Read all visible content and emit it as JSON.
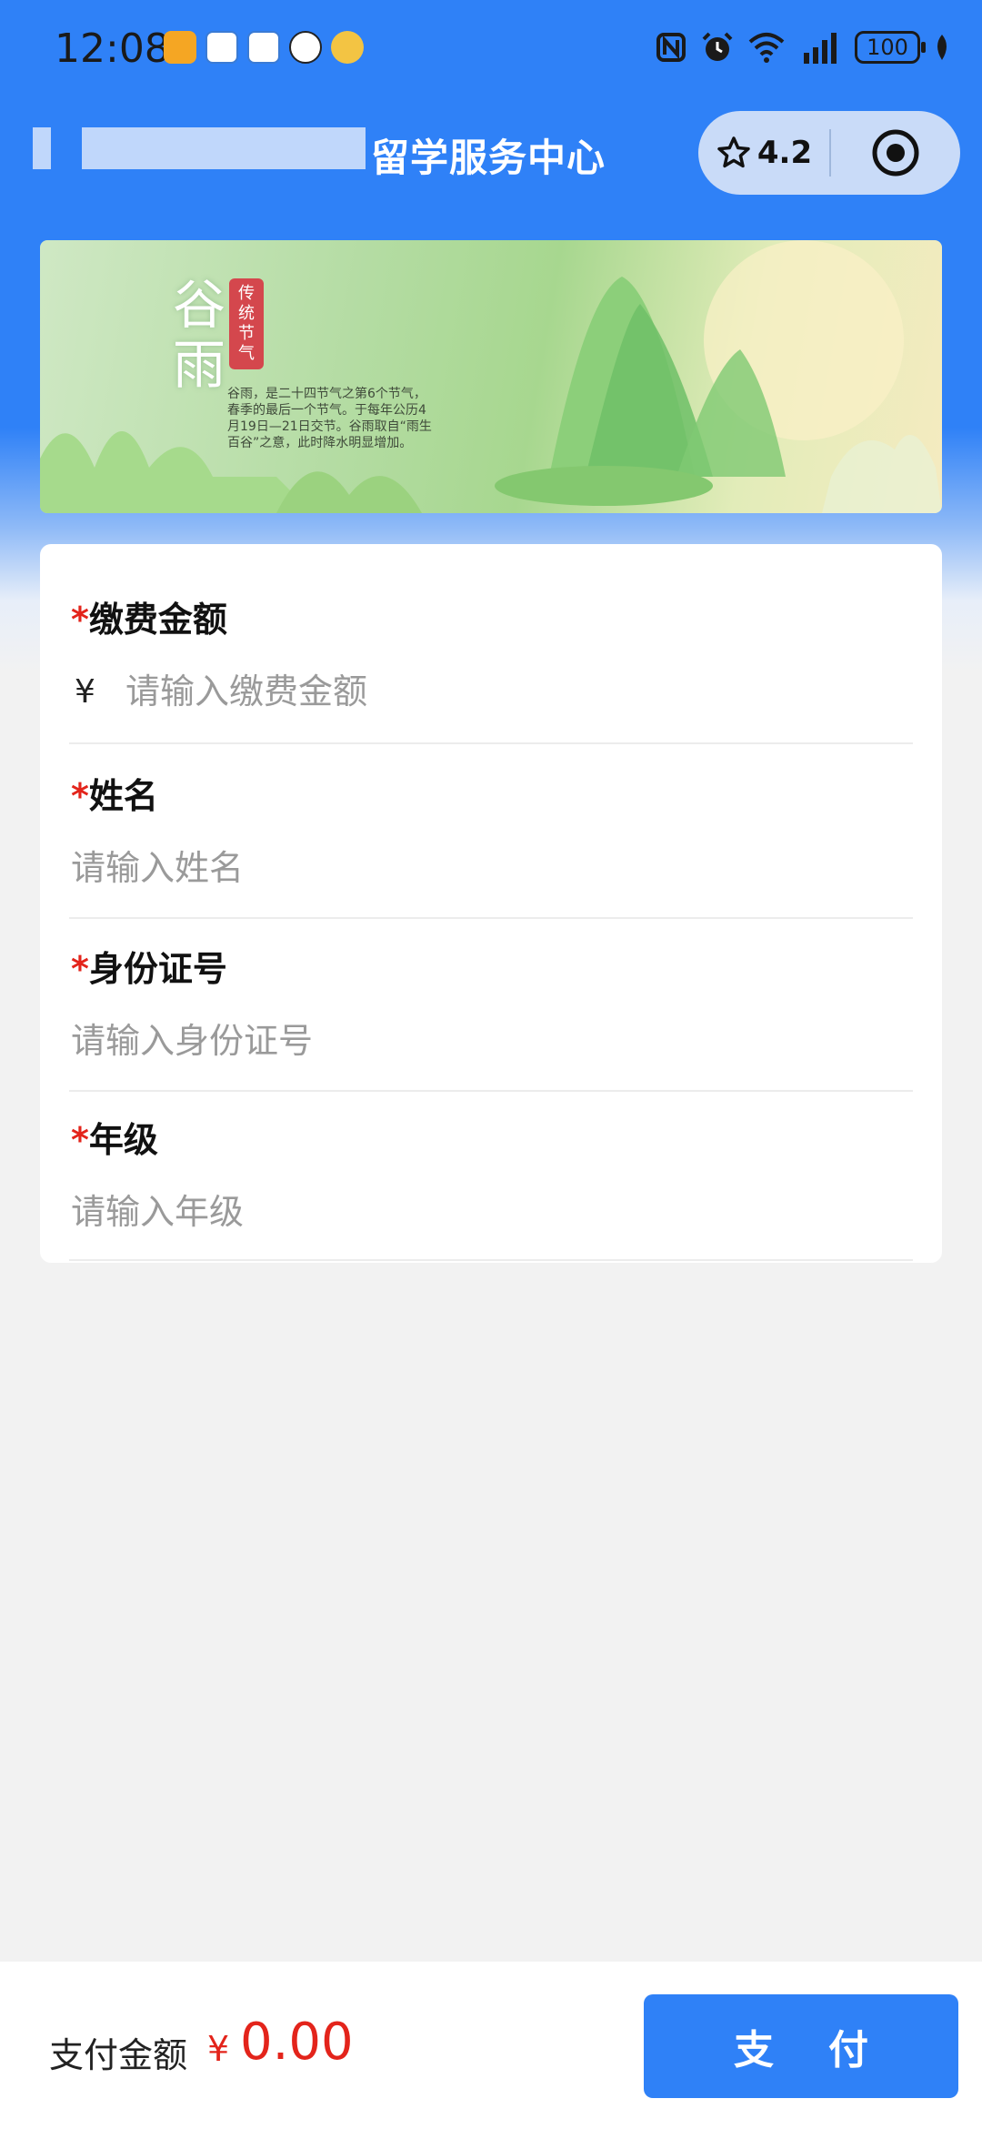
{
  "status_bar": {
    "time": "12:08",
    "battery": "100"
  },
  "header": {
    "title": "留学服务中心",
    "rating": "4.2"
  },
  "banner": {
    "title": "谷雨",
    "seal": "传统节气",
    "description": "谷雨，是二十四节气之第6个节气，春季的最后一个节气。于每年公历4月19日—21日交节。谷雨取自“雨生百谷”之意，此时降水明显增加。"
  },
  "form": {
    "fields": [
      {
        "required_mark": "*",
        "label": "缴费金额",
        "currency": "¥",
        "placeholder": "请输入缴费金额"
      },
      {
        "required_mark": "*",
        "label": "姓名",
        "placeholder": "请输入姓名"
      },
      {
        "required_mark": "*",
        "label": "身份证号",
        "placeholder": "请输入身份证号"
      },
      {
        "required_mark": "*",
        "label": "年级",
        "placeholder": "请输入年级"
      }
    ]
  },
  "footer": {
    "pay_label": "支付金额",
    "currency": "¥",
    "amount": "0.00",
    "pay_button": "支付"
  },
  "colors": {
    "brand_blue": "#2f81f7",
    "required_red": "#e3241b",
    "background": "#f2f2f2"
  },
  "icons": [
    "mail-icon",
    "chat-icon",
    "app-icon",
    "sf-express-icon",
    "weather-icon",
    "nfc-icon",
    "alarm-icon",
    "wifi-icon",
    "signal-icon",
    "leaf-icon",
    "star-icon",
    "target-icon"
  ]
}
